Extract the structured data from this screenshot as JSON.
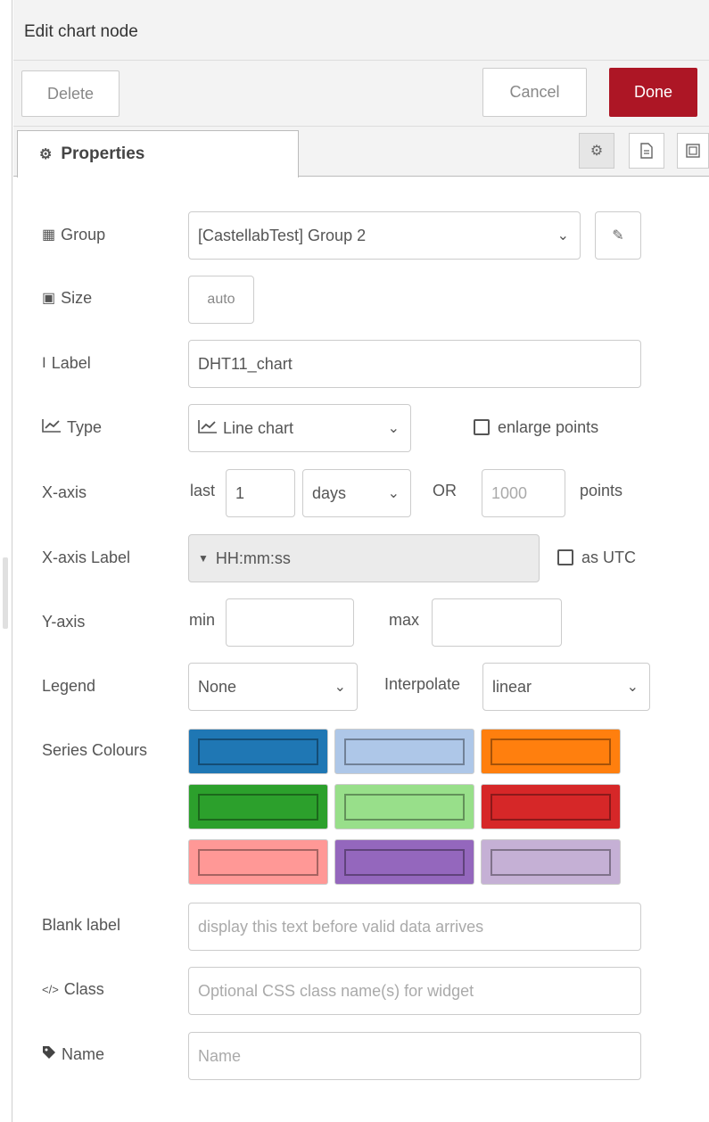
{
  "header": {
    "title": "Edit chart node"
  },
  "toolbar": {
    "delete_label": "Delete",
    "cancel_label": "Cancel",
    "done_label": "Done"
  },
  "tabs": {
    "active_label": "Properties",
    "icons": [
      "gear-icon",
      "description-icon",
      "node-appearance-icon"
    ]
  },
  "form": {
    "group": {
      "label": "Group",
      "value": "[CastellabTest] Group 2"
    },
    "size": {
      "label": "Size",
      "value": "auto"
    },
    "label": {
      "label": "Label",
      "value": "DHT11_chart"
    },
    "type": {
      "label": "Type",
      "value": "Line chart",
      "enlarge_points_label": "enlarge points",
      "enlarge_points_checked": false
    },
    "xaxis": {
      "label": "X-axis",
      "last_text": "last",
      "last_value": "1",
      "unit_value": "days",
      "or_text": "OR",
      "points_placeholder": "1000",
      "points_text": "points"
    },
    "xaxis_label": {
      "label": "X-axis Label",
      "value": "HH:mm:ss",
      "as_utc_label": "as UTC",
      "as_utc_checked": false
    },
    "yaxis": {
      "label": "Y-axis",
      "min_text": "min",
      "min_value": "",
      "max_text": "max",
      "max_value": ""
    },
    "legend": {
      "label": "Legend",
      "value": "None",
      "interpolate_label": "Interpolate",
      "interpolate_value": "linear"
    },
    "series_colours": {
      "label": "Series Colours",
      "colors": [
        "#1f77b4",
        "#aec7e8",
        "#ff7f0e",
        "#2ca02c",
        "#98df8a",
        "#d62728",
        "#ff9896",
        "#9467bd",
        "#c5b0d5"
      ]
    },
    "blank_label": {
      "label": "Blank label",
      "placeholder": "display this text before valid data arrives"
    },
    "class": {
      "label": "Class",
      "placeholder": "Optional CSS class name(s) for widget"
    },
    "name": {
      "label": "Name",
      "placeholder": "Name"
    }
  },
  "colors": {
    "accent_done": "#ad1625",
    "panel_bg": "#f3f3f3"
  }
}
